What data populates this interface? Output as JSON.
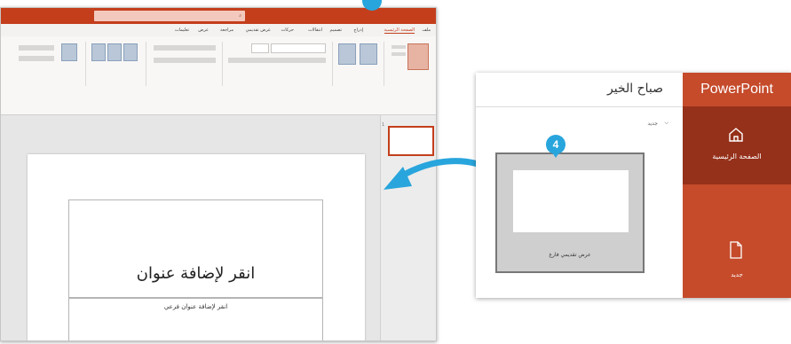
{
  "editor": {
    "title_search": "",
    "tabs": [
      {
        "label": "ملف",
        "active": false
      },
      {
        "label": "الصفحة الرئيسية",
        "active": true
      },
      {
        "label": "إدراج",
        "active": false
      },
      {
        "label": "تصميم",
        "active": false
      },
      {
        "label": "انتقالات",
        "active": false
      },
      {
        "label": "حركات",
        "active": false
      },
      {
        "label": "عرض تقديمي",
        "active": false
      },
      {
        "label": "مراجعة",
        "active": false
      },
      {
        "label": "عرض",
        "active": false
      },
      {
        "label": "تعليمات",
        "active": false
      }
    ],
    "slide": {
      "title_placeholder": "انقر لإضافة عنوان",
      "subtitle_placeholder": "انقر لإضافة عنوان فرعي"
    },
    "thumbnail_number": "1"
  },
  "start_screen": {
    "brand": "PowerPoint",
    "greeting": "صباح الخير",
    "nav": [
      {
        "label": "الصفحة الرئيسية",
        "icon": "home-icon"
      },
      {
        "label": "جديد",
        "icon": "new-file-icon"
      }
    ],
    "new_section_label": "جديد",
    "template_label": "عرض تقديمي فارغ",
    "step_badge": "4"
  },
  "colors": {
    "accent": "#c43e1c",
    "sidebar": "#b7472a",
    "sidebar_selected": "#95301a",
    "marker": "#28a5dc"
  }
}
